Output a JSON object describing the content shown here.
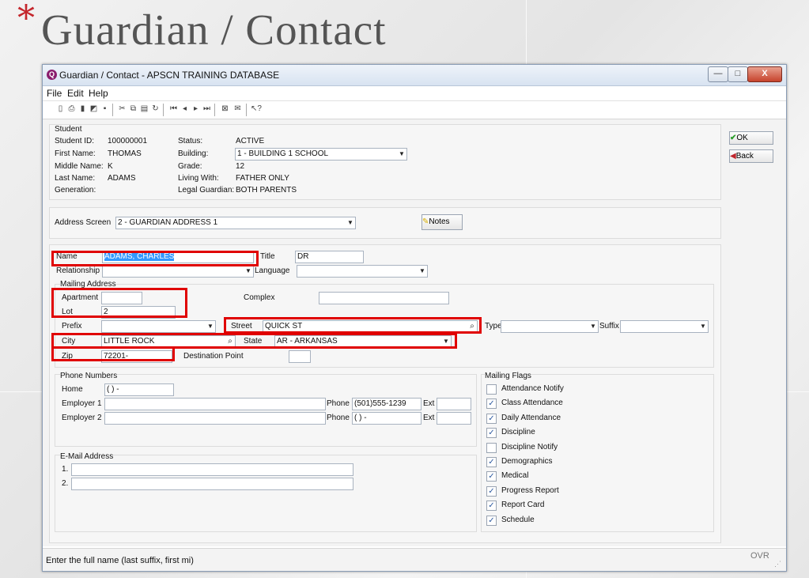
{
  "slide": {
    "star": "*",
    "title": "Guardian / Contact"
  },
  "window": {
    "title": "Guardian / Contact - APSCN TRAINING DATABASE",
    "app_icon": "apscn-app-icon",
    "min": "—",
    "max": "□",
    "close": "X"
  },
  "menu": {
    "file": "File",
    "edit": "Edit",
    "help": "Help"
  },
  "student": {
    "group_label": "Student",
    "id_label": "Student ID:",
    "id": "100000001",
    "first_label": "First Name:",
    "first": "THOMAS",
    "middle_label": "Middle Name:",
    "middle": "K",
    "last_label": "Last Name:",
    "last": "ADAMS",
    "gen_label": "Generation:",
    "status_label": "Status:",
    "status": "ACTIVE",
    "building_label": "Building:",
    "building": "1 - BUILDING 1 SCHOOL",
    "grade_label": "Grade:",
    "grade": "12",
    "living_label": "Living With:",
    "living": "FATHER ONLY",
    "legal_label": "Legal Guardian:",
    "legal": "BOTH PARENTS"
  },
  "address_screen": {
    "label": "Address Screen",
    "value": "2 - GUARDIAN ADDRESS 1",
    "notes": "Notes"
  },
  "buttons": {
    "ok": "OK",
    "back": "Back"
  },
  "guardian": {
    "name_label": "Name",
    "name": "ADAMS, CHARLES",
    "title_label": "Title",
    "title": "DR",
    "relationship_label": "Relationship",
    "relationship": "",
    "language_label": "Language",
    "language": "",
    "mailing_label": "Mailing Address",
    "apartment_label": "Apartment",
    "apartment": "",
    "complex_label": "Complex",
    "complex": "",
    "lot_label": "Lot",
    "lot": "2",
    "prefix_label": "Prefix",
    "prefix": "",
    "street_label": "Street",
    "street": "QUICK ST",
    "type_label": "Type",
    "type": "",
    "suffix_label": "Suffix",
    "suffix": "",
    "city_label": "City",
    "city": "LITTLE ROCK",
    "state_label": "State",
    "state": "AR - ARKANSAS",
    "zip_label": "Zip",
    "zip": "72201-",
    "dest_label": "Destination Point",
    "dest": ""
  },
  "phones": {
    "group_label": "Phone Numbers",
    "home_label": "Home",
    "home": "(  )  -",
    "emp1_label": "Employer 1",
    "emp1": "",
    "emp1_phone_label": "Phone",
    "emp1_phone": "(501)555-1239",
    "emp1_ext_label": "Ext",
    "emp1_ext": "",
    "emp2_label": "Employer 2",
    "emp2": "",
    "emp2_phone_label": "Phone",
    "emp2_phone": "(  )  -",
    "emp2_ext_label": "Ext",
    "emp2_ext": ""
  },
  "email": {
    "group_label": "E-Mail Address",
    "l1": "1.",
    "e1": "",
    "l2": "2.",
    "e2": ""
  },
  "flags": {
    "group_label": "Mailing Flags",
    "items": [
      {
        "label": "Attendance Notify",
        "checked": false
      },
      {
        "label": "Class Attendance",
        "checked": true
      },
      {
        "label": "Daily Attendance",
        "checked": true
      },
      {
        "label": "Discipline",
        "checked": true
      },
      {
        "label": "Discipline Notify",
        "checked": false
      },
      {
        "label": "Demographics",
        "checked": true
      },
      {
        "label": "Medical",
        "checked": true
      },
      {
        "label": "Progress Report",
        "checked": true
      },
      {
        "label": "Report Card",
        "checked": true
      },
      {
        "label": "Schedule",
        "checked": true
      }
    ]
  },
  "status": {
    "message": "Enter the full name (last suffix, first mi)",
    "mode": "OVR"
  }
}
